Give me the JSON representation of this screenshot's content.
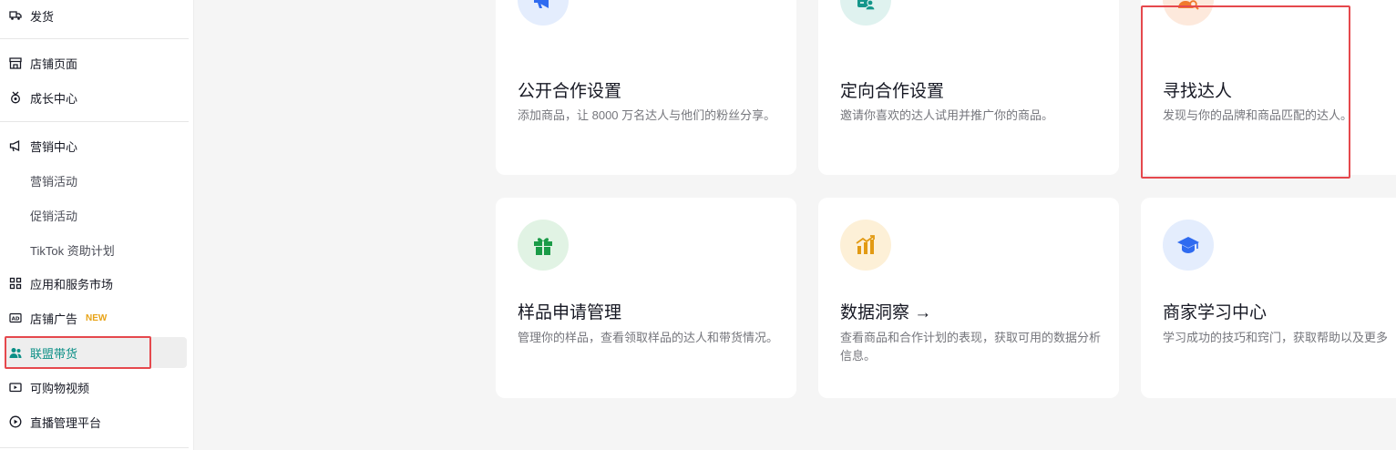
{
  "sidebar": {
    "items": [
      {
        "label": "发货",
        "icon": "truck-icon"
      },
      {
        "label": "店铺页面",
        "icon": "store-icon"
      },
      {
        "label": "成长中心",
        "icon": "medal-icon"
      },
      {
        "label": "营销中心",
        "icon": "megaphone-icon"
      },
      {
        "label": "营销活动"
      },
      {
        "label": "促销活动"
      },
      {
        "label": "TikTok 资助计划"
      },
      {
        "label": "应用和服务市场",
        "icon": "apps-icon"
      },
      {
        "label": "店铺广告",
        "icon": "ad-icon",
        "badge": "NEW"
      },
      {
        "label": "联盟带货",
        "icon": "users-icon",
        "active": true
      },
      {
        "label": "可购物视频",
        "icon": "video-icon"
      },
      {
        "label": "直播管理平台",
        "icon": "live-icon"
      }
    ]
  },
  "cards": [
    {
      "title": "公开合作设置",
      "desc": "添加商品，让 8000 万名达人与他们的粉丝分享。",
      "icon": "megaphone-icon",
      "icon_bg": "#e4edfd",
      "icon_color": "#2f6bf0"
    },
    {
      "title": "定向合作设置",
      "desc": "邀请你喜欢的达人试用并推广你的商品。",
      "icon": "targeted-doc-icon",
      "icon_bg": "#dff2ef",
      "icon_color": "#14968a"
    },
    {
      "title": "寻找达人",
      "desc": "发现与你的品牌和商品匹配的达人。",
      "icon": "person-search-icon",
      "icon_bg": "#fde9dc",
      "icon_color": "#f07a2c"
    },
    {
      "title": "样品申请管理",
      "desc": "管理你的样品，查看领取样品的达人和带货情况。",
      "icon": "gift-icon",
      "icon_bg": "#e1f3e4",
      "icon_color": "#1a9b47"
    },
    {
      "title": "数据洞察 →",
      "desc": "查看商品和合作计划的表现，获取可用的数据分析信息。",
      "icon": "bar-chart-icon",
      "icon_bg": "#fdf0d7",
      "icon_color": "#e29a13"
    },
    {
      "title": "商家学习中心",
      "desc": "学习成功的技巧和窍门，获取帮助以及更多",
      "icon": "graduation-cap-icon",
      "icon_bg": "#e4edfd",
      "icon_color": "#2f6bf0"
    }
  ],
  "colors": {
    "accent": "#0b8f86",
    "highlight": "#e5484d",
    "new_badge": "#e8a317"
  }
}
